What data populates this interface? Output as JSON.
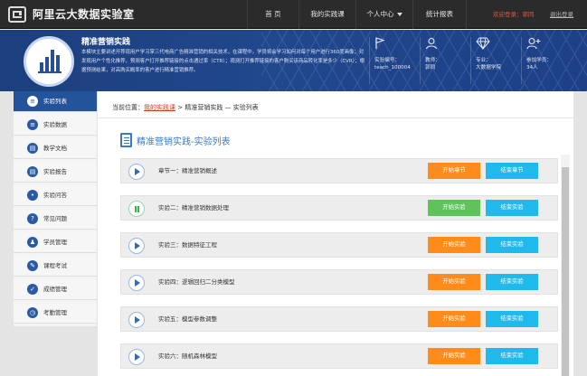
{
  "header": {
    "site_title": "阿里云大数据实验室",
    "nav": [
      "首  页",
      "我的实践课",
      "个人中心",
      "统计报表"
    ],
    "welcome": "欢迎登录：郭同",
    "logout": "退出登录"
  },
  "course": {
    "name": "精准营销实践",
    "description": "本模块主要讲述开荐现用户学习掌三代电商广告精准营销的相关技术，在课程中，学员将会学习如何对每个用户进行360度画像；对发现用户个性化推荐，预测客户打开推荐链接的点击通过率（CTR）；观测打开推荐链接的客户购买该商品转化率是多少（CVR）；根据预测结果，对高购买概率的客户进行精准营销推荐。",
    "meta": [
      {
        "icon": "flag-icon",
        "label": "实验编号：",
        "value": "teach_100004"
      },
      {
        "icon": "teacher-icon",
        "label": "教师：",
        "value": "郭同"
      },
      {
        "icon": "diamond-icon",
        "label": "专业：",
        "value": "大数据学院"
      },
      {
        "icon": "add-user-icon",
        "label": "参加学员：",
        "value": "34人"
      }
    ]
  },
  "sidebar": {
    "items": [
      "实验列表",
      "实验数据",
      "教学文档",
      "实验报告",
      "实验问答",
      "常见问题",
      "学员管理",
      "课程考试",
      "成绩管理",
      "考勤管理"
    ]
  },
  "main": {
    "breadcrumb_prefix": "当前位置：",
    "breadcrumb_link": "我的实践课",
    "breadcrumb_rest": " > 精准营销实践 — 实验列表",
    "list_title": "精准营销实践-实验列表",
    "rows": [
      {
        "label": "章节一：精准营销概述",
        "start": "开始章节",
        "end": "结束章节",
        "state": "play"
      },
      {
        "label": "实验二：精准营销数据处理",
        "start": "开始实验",
        "end": "结束实验",
        "state": "pause"
      },
      {
        "label": "实验三：数据特征工程",
        "start": "开始实验",
        "end": "结束实验",
        "state": "play"
      },
      {
        "label": "实验四：逻辑回归二分类模型",
        "start": "开始实验",
        "end": "结束实验",
        "state": "play"
      },
      {
        "label": "实验五：模型参数调整",
        "start": "开始实验",
        "end": "结束实验",
        "state": "play"
      },
      {
        "label": "实验六：随机森林模型",
        "start": "开始实验",
        "end": "结束实验",
        "state": "play"
      }
    ]
  },
  "colors": {
    "accent": "#23549b",
    "start_button": "#ff8c1a",
    "start_button_running": "#5fc25b",
    "end_button": "#1fb9ec",
    "link_red": "#d23b2b"
  }
}
